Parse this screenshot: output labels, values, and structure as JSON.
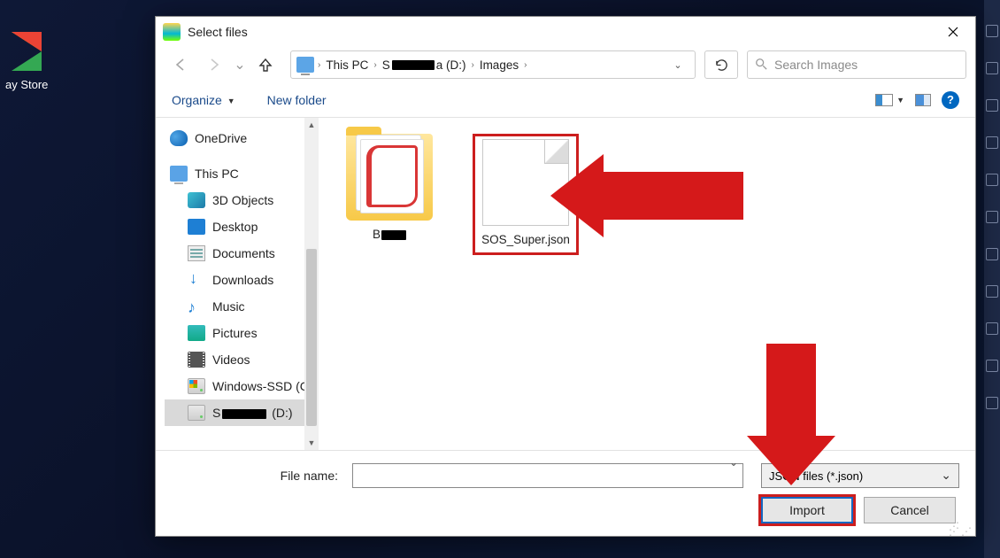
{
  "bg": {
    "play_label": "ay Store"
  },
  "dialog": {
    "title": "Select files",
    "nav": {
      "breadcrumb": {
        "seg1": "This PC",
        "seg2_prefix": "S",
        "seg2_suffix": "a (D:)",
        "seg3": "Images"
      },
      "search_placeholder": "Search Images"
    },
    "toolbar": {
      "organize": "Organize",
      "newfolder": "New folder"
    },
    "tree": {
      "onedrive": "OneDrive",
      "thispc": "This PC",
      "items": [
        "3D Objects",
        "Desktop",
        "Documents",
        "Downloads",
        "Music",
        "Pictures",
        "Videos",
        "Windows-SSD (C"
      ],
      "selected_prefix": "S",
      "selected_suffix": " (D:)"
    },
    "files": {
      "folder_prefix": "B",
      "file1": "SOS_Super.json"
    },
    "footer": {
      "filename_label": "File name:",
      "filename_value": "",
      "filetype": "JSON files (*.json)",
      "import": "Import",
      "cancel": "Cancel"
    }
  }
}
